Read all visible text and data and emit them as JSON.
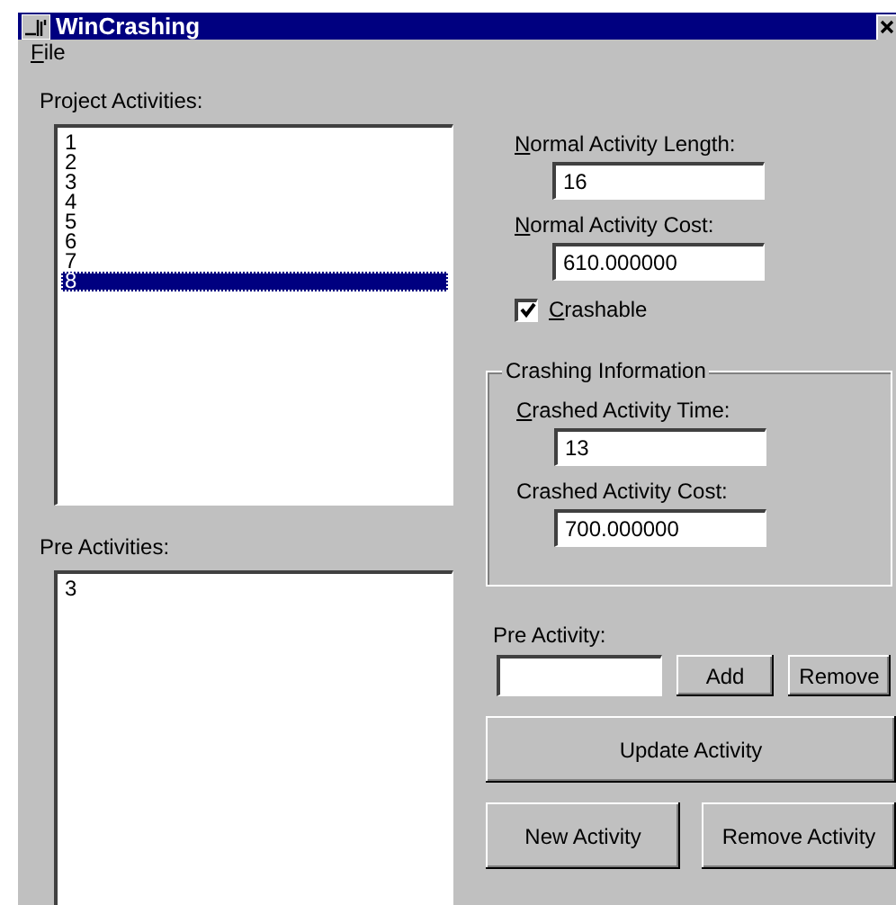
{
  "window": {
    "title": "WinCrashing"
  },
  "menu": [
    {
      "label": "File",
      "mnemonic": true
    }
  ],
  "project_activities": {
    "label": "Project Activities:",
    "items": [
      {
        "label": "1",
        "selected": false
      },
      {
        "label": "2",
        "selected": false
      },
      {
        "label": "3",
        "selected": false
      },
      {
        "label": "4",
        "selected": false
      },
      {
        "label": "5",
        "selected": false
      },
      {
        "label": "6",
        "selected": false
      },
      {
        "label": "7",
        "selected": false
      },
      {
        "label": "8",
        "selected": true
      }
    ]
  },
  "pre_activities": {
    "label": "Pre Activities:",
    "items": [
      {
        "label": "3",
        "selected": false
      }
    ]
  },
  "normal_length": {
    "label": "Normal Activity Length:",
    "mnemonic": true,
    "value": "16"
  },
  "normal_cost": {
    "label": "Normal Activity Cost:",
    "mnemonic": true,
    "value": "610.000000"
  },
  "crashable": {
    "label": "Crashable",
    "mnemonic": true,
    "checked": true
  },
  "crashing_info": {
    "title": "Crashing Information",
    "crashed_time": {
      "label": "Crashed Activity Time:",
      "mnemonic": true,
      "value": "13"
    },
    "crashed_cost": {
      "label": "Crashed Activity Cost:",
      "value": "700.000000"
    }
  },
  "pre_activity": {
    "label": "Pre Activity:",
    "add": "Add",
    "remove": "Remove"
  },
  "buttons": {
    "update": "Update Activity",
    "new": "New Activity",
    "remove": "Remove Activity"
  }
}
